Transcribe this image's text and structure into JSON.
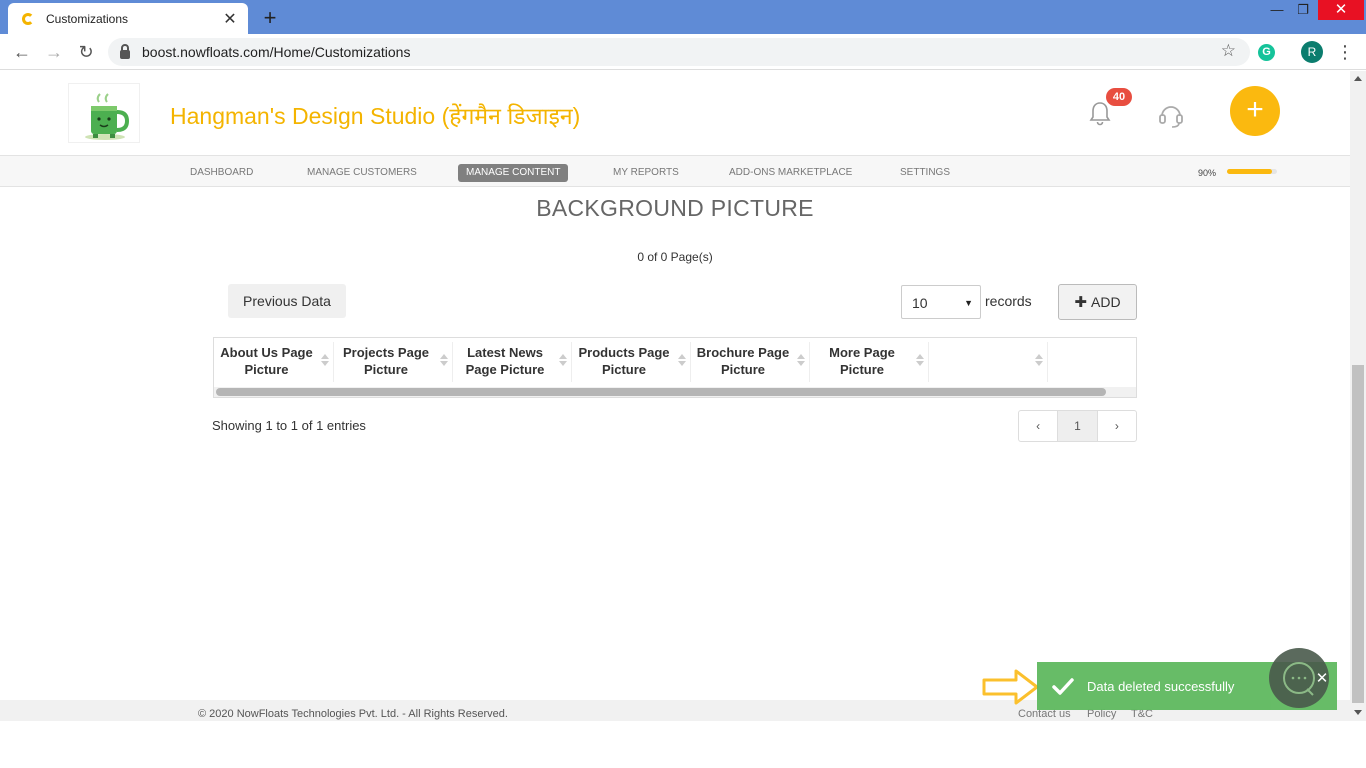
{
  "browser": {
    "tab_title": "Customizations",
    "tab_close": "✕",
    "new_tab": "+",
    "url": "boost.nowfloats.com/Home/Customizations",
    "profile_initial": "R",
    "grammarly_letter": "G",
    "window_controls": {
      "minimize": "—",
      "restore": "❐",
      "close": "✕"
    }
  },
  "header": {
    "brand": "Hangman's Design Studio (हेंगमैन डिजाइन)",
    "notification_count": "40",
    "fab_label": "+"
  },
  "nav": {
    "items": [
      "DASHBOARD",
      "MANAGE CUSTOMERS",
      "MANAGE CONTENT",
      "MY REPORTS",
      "ADD-ONS MARKETPLACE",
      "SETTINGS"
    ],
    "active": "MANAGE CONTENT",
    "progress_label": "90%",
    "progress_value": 0.9
  },
  "main": {
    "title": "BACKGROUND PICTURE",
    "page_count": "0 of 0 Page(s)",
    "previous_button": "Previous Data",
    "records_value": "10",
    "records_label": "records",
    "add_button": "ADD",
    "table_headers": [
      "About Us Page Picture",
      "Projects Page Picture",
      "Latest News Page Picture",
      "Products Page Picture",
      "Brochure Page Picture",
      "More Page Picture",
      "",
      ""
    ],
    "showing_text": "Showing 1 to 1 of 1 entries",
    "pager": {
      "prev": "‹",
      "current": "1",
      "next": "›"
    }
  },
  "footer": {
    "copyright": "© 2020 NowFloats Technologies Pvt. Ltd. - All Rights Reserved.",
    "links": [
      "Contact us",
      "Policy",
      "T&C"
    ]
  },
  "toast": {
    "message": "Data deleted successfully",
    "close": "✕"
  },
  "colors": {
    "brand": "#f4b400",
    "toast": "#5cb85c",
    "badge": "#e84e40",
    "annotation_arrow": "#fbc02d"
  }
}
